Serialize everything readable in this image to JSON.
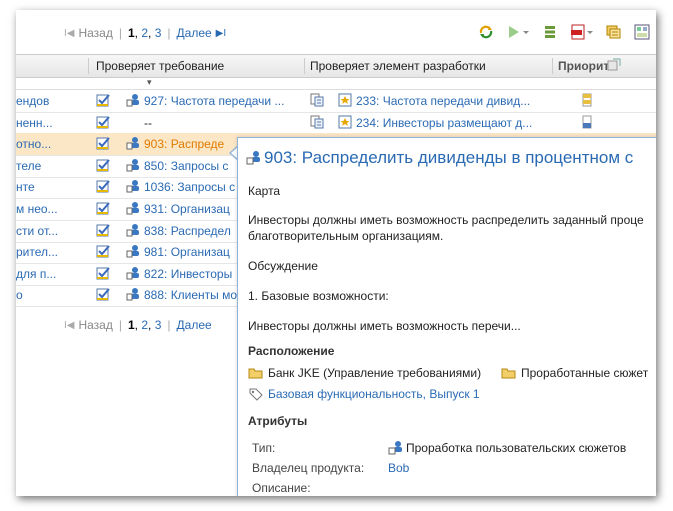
{
  "pager": {
    "prev": "Назад",
    "pages": [
      "1",
      "2",
      "3"
    ],
    "next": "Далее"
  },
  "toolbar": {
    "icons": [
      "refresh-icon",
      "run-icon",
      "columns-icon",
      "pdf-export-icon",
      "filter-icon",
      "settings-icon"
    ]
  },
  "columns": {
    "validates_requirement": "Проверяет требование",
    "validates_work_item": "Проверяет элемент разработки",
    "priority": "Приорит"
  },
  "rows": [
    {
      "c1": "ендов",
      "req": "927: Частота передачи ...",
      "work": "233: Частота передачи дивид..."
    },
    {
      "c1": "ненн...",
      "req": "--",
      "work": "234: Инвесторы размещают д..."
    },
    {
      "c1": "отно...",
      "req": "903: Распреде"
    },
    {
      "c1": "теле",
      "req": "850: Запросы с"
    },
    {
      "c1": "нте",
      "req": "1036: Запросы с"
    },
    {
      "c1": "м нео...",
      "req": "931: Организац"
    },
    {
      "c1": "сти от...",
      "req": "838: Распредел"
    },
    {
      "c1": "рител...",
      "req": "981: Организац"
    },
    {
      "c1": "для п...",
      "req": "822: Инвесторы"
    },
    {
      "c1": "о",
      "req": "888: Клиенты мо"
    }
  ],
  "popup": {
    "title": "903: Распределить дивиденды в процентном с",
    "section1": "Карта",
    "text1": "Инвесторы должны иметь возможность распределить заданный проце",
    "text2": "благотворительным организациям.",
    "section2": "Обсуждение",
    "text3": "1. Базовые возможности:",
    "text4": "Инвесторы должны иметь возможность перечи...",
    "location_heading": "Расположение",
    "location_project": "Банк JKE (Управление требованиями)",
    "location_folder": "Проработанные сюжет",
    "location_tags": "Базовая функциональность,  Выпуск 1",
    "attributes_heading": "Атрибуты",
    "attr_type_label": "Тип:",
    "attr_type_value": "Проработка пользовательских сюжетов",
    "attr_owner_label": "Владелец продукта:",
    "attr_owner_value": "Bob",
    "attr_desc_label": "Описание:"
  },
  "colors": {
    "link": "#2a6ab3",
    "selected_row": "#fbe7c6",
    "selected_link": "#e07a00"
  }
}
